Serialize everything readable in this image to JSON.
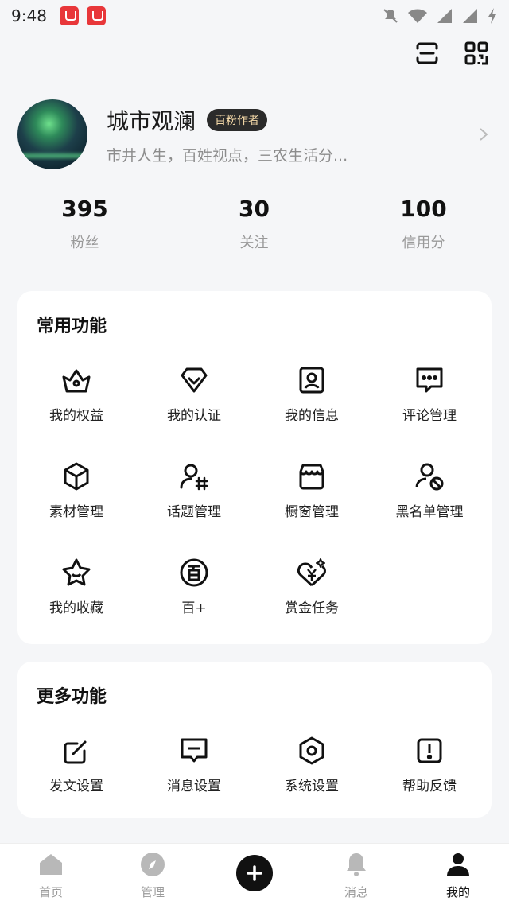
{
  "status_bar": {
    "time": "9:48"
  },
  "profile": {
    "name": "城市观澜",
    "tag": "百粉作者",
    "bio": "市井人生，百姓视点，三农生活分..."
  },
  "stats": [
    {
      "value": "395",
      "label": "粉丝"
    },
    {
      "value": "30",
      "label": "关注"
    },
    {
      "value": "100",
      "label": "信用分"
    }
  ],
  "common": {
    "title": "常用功能",
    "items": [
      {
        "label": "我的权益",
        "icon": "crown-icon"
      },
      {
        "label": "我的认证",
        "icon": "diamond-heart-icon"
      },
      {
        "label": "我的信息",
        "icon": "id-card-icon"
      },
      {
        "label": "评论管理",
        "icon": "comment-icon"
      },
      {
        "label": "素材管理",
        "icon": "box-icon"
      },
      {
        "label": "话题管理",
        "icon": "topic-icon"
      },
      {
        "label": "橱窗管理",
        "icon": "store-icon"
      },
      {
        "label": "黑名单管理",
        "icon": "block-user-icon"
      },
      {
        "label": "我的收藏",
        "icon": "star-icon"
      },
      {
        "label": "百+",
        "icon": "bai-plus-icon"
      },
      {
        "label": "赏金任务",
        "icon": "bounty-icon"
      }
    ]
  },
  "more": {
    "title": "更多功能",
    "items": [
      {
        "label": "发文设置",
        "icon": "edit-icon"
      },
      {
        "label": "消息设置",
        "icon": "message-icon"
      },
      {
        "label": "系统设置",
        "icon": "settings-icon"
      },
      {
        "label": "帮助反馈",
        "icon": "help-icon"
      }
    ]
  },
  "nav": {
    "items": [
      {
        "label": "首页",
        "icon": "home-icon"
      },
      {
        "label": "管理",
        "icon": "compass-icon"
      },
      {
        "label": "消息",
        "icon": "bell-icon"
      },
      {
        "label": "我的",
        "icon": "user-icon"
      }
    ],
    "active_index": 3
  }
}
